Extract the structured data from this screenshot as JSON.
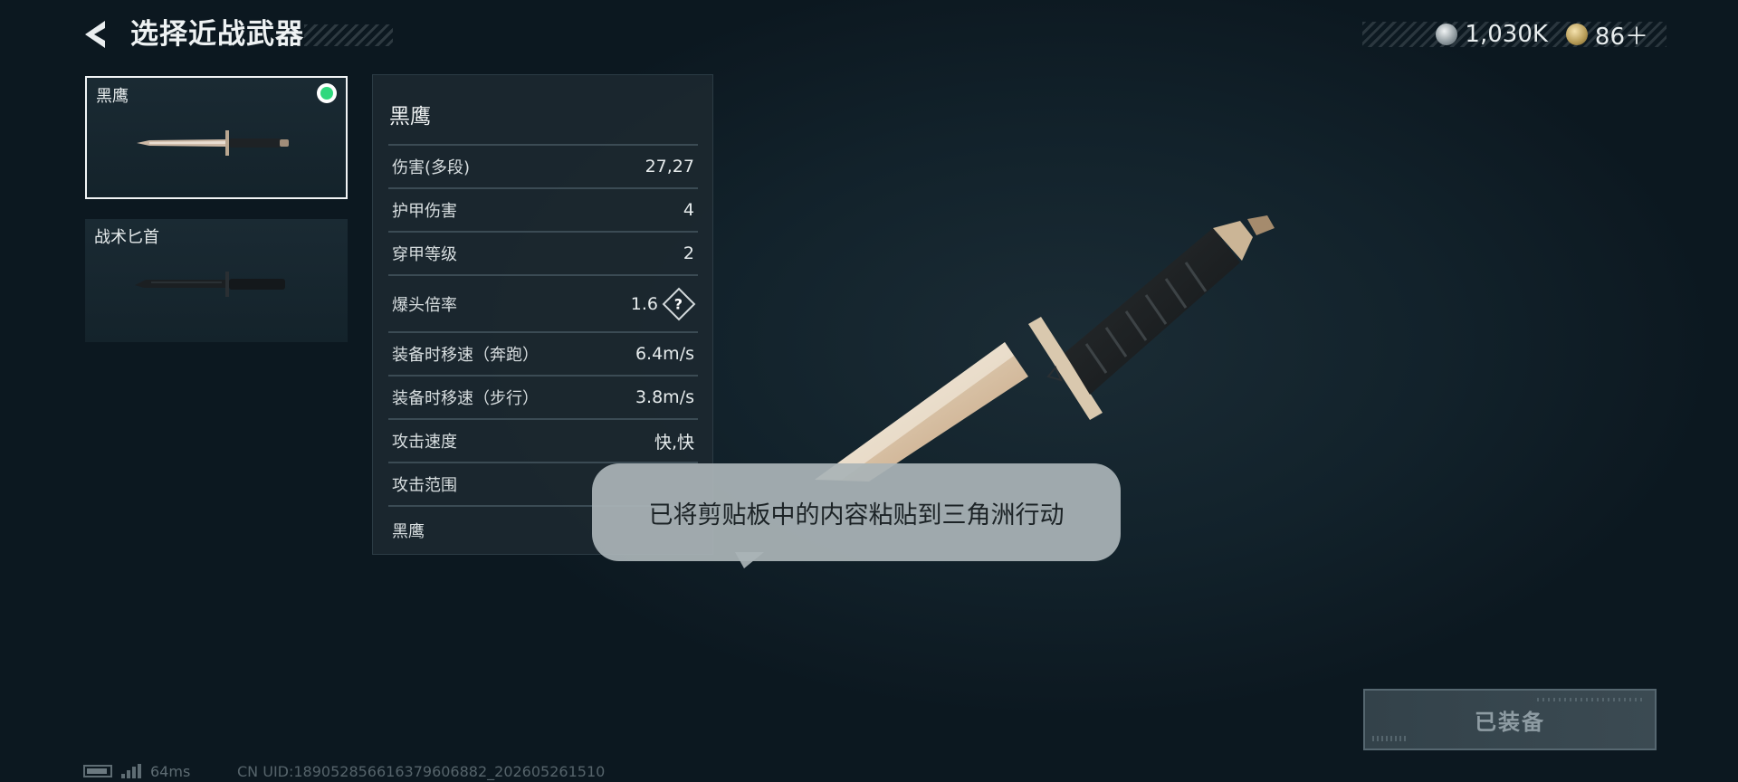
{
  "header": {
    "title": "选择近战武器",
    "currencies": [
      {
        "icon": "silver-coin-icon",
        "value": "1,030K"
      },
      {
        "icon": "gold-coin-icon",
        "value": "86＋"
      }
    ]
  },
  "weapons": [
    {
      "name": "黑鹰",
      "selected": true,
      "equipped": true
    },
    {
      "name": "战术匕首",
      "selected": false,
      "equipped": false
    }
  ],
  "details": {
    "name": "黑鹰",
    "stats": [
      {
        "label": "伤害(多段)",
        "value": "27,27"
      },
      {
        "label": "护甲伤害",
        "value": "4"
      },
      {
        "label": "穿甲等级",
        "value": "2"
      },
      {
        "label": "爆头倍率",
        "value": "1.6",
        "help": "?"
      },
      {
        "label": "装备时移速（奔跑）",
        "value": "6.4m/s"
      },
      {
        "label": "装备时移速（步行）",
        "value": "3.8m/s"
      },
      {
        "label": "攻击速度",
        "value": "快,快"
      },
      {
        "label": "攻击范围",
        "value": ""
      },
      {
        "label": "黑鹰",
        "value": ""
      }
    ]
  },
  "toast": {
    "text": "已将剪贴板中的内容粘贴到三角洲行动"
  },
  "equip_button": {
    "label": "已装备"
  },
  "status": {
    "ping": "64ms",
    "uid": "CN UID:18905285661637960688​2_202605261510"
  },
  "colors": {
    "equipped": "#2fd87d",
    "background": "#0d1a21",
    "panel": "#1c282f",
    "toast": "#aab4b7"
  }
}
